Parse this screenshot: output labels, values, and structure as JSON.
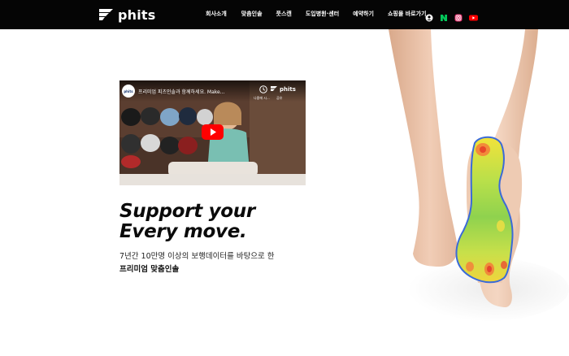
{
  "header": {
    "logo_text": "phits",
    "nav": [
      {
        "label": "회사소개"
      },
      {
        "label": "맞춤인솔"
      },
      {
        "label": "풋스캔"
      },
      {
        "label": "도입병원·센터"
      },
      {
        "label": "예약하기"
      },
      {
        "label": "쇼핑몰 바로가기"
      }
    ],
    "icons": [
      "user-icon",
      "naver-icon",
      "instagram-icon",
      "youtube-icon"
    ]
  },
  "video": {
    "channel_avatar": "phits",
    "title": "프리미엄 피츠인솔과 함께하세요. Make...",
    "watch_later_label": "나중에 시...",
    "brand_mark": "phits",
    "share_label": "공유",
    "play_icon": "youtube-play-icon"
  },
  "hero": {
    "headline_line1": "Support your",
    "headline_line2": "Every move.",
    "subtext": "7년간 10만명 이상의 보행데이터를 바탕으로 한",
    "subtext_bold": "프리미엄 맞춤인솔"
  },
  "colors": {
    "header_bg": "#050505",
    "youtube_red": "#ff0000",
    "naver_green": "#03c75a",
    "instagram": "#e1306c"
  }
}
